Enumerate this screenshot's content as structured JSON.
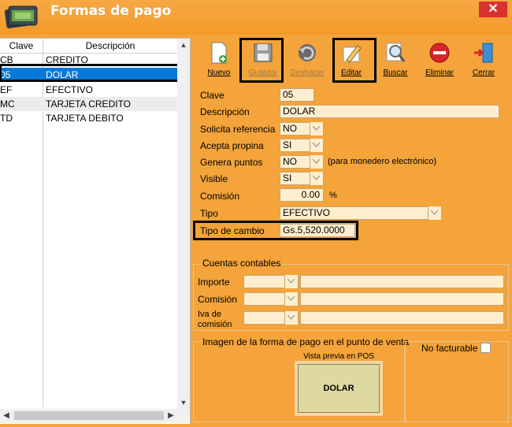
{
  "window": {
    "title": "Formas de pago",
    "close_symbol": "✕"
  },
  "list": {
    "headers": {
      "clave": "Clave",
      "descripcion": "Descripción"
    },
    "rows": [
      {
        "clave": "CB",
        "descripcion": "CREDITO"
      },
      {
        "clave": "05",
        "descripcion": "DOLAR",
        "selected": true
      },
      {
        "clave": "EF",
        "descripcion": "EFECTIVO"
      },
      {
        "clave": "MC",
        "descripcion": "TARJETA CREDITO"
      },
      {
        "clave": "TD",
        "descripcion": "TARJETA DEBITO"
      }
    ]
  },
  "toolbar": {
    "nuevo": "Nuevo",
    "guardar": "Guardar",
    "deshacer": "Deshacer",
    "editar": "Editar",
    "buscar": "Buscar",
    "eliminar": "Eliminar",
    "cerrar": "Cerrar"
  },
  "form": {
    "clave": {
      "label": "Clave",
      "value": "05"
    },
    "descripcion": {
      "label": "Descripción",
      "value": "DOLAR"
    },
    "solicita_referencia": {
      "label": "Solicita referencia",
      "value": "NO"
    },
    "acepta_propina": {
      "label": "Acepta propina",
      "value": "SI"
    },
    "genera_puntos": {
      "label": "Genera puntos",
      "value": "NO",
      "hint": "(para monedero electrónico)"
    },
    "visible": {
      "label": "Visible",
      "value": "SI"
    },
    "comision": {
      "label": "Comisión",
      "value": "0.00",
      "unit": "%"
    },
    "tipo": {
      "label": "Tipo",
      "value": "EFECTIVO"
    },
    "tipo_cambio": {
      "label": "Tipo de cambio",
      "value": "Gs.5,520.0000"
    }
  },
  "cuentas": {
    "title": "Cuentas contables",
    "importe": "Importe",
    "comision": "Comisión",
    "iva_1": "Iva de",
    "iva_2": "comisión"
  },
  "imagen": {
    "title": "Imagen de la forma de pago en el punto de venta",
    "preview_label": "Vista previa en POS",
    "preview_text": "DOLAR"
  },
  "no_facturable": {
    "label": "No facturable",
    "checked": false
  }
}
